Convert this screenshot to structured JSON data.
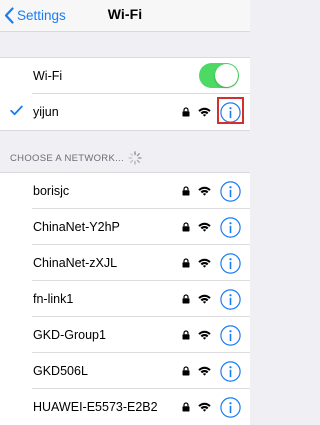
{
  "nav": {
    "back_label": "Settings",
    "title": "Wi-Fi"
  },
  "wifi_toggle": {
    "label": "Wi-Fi",
    "on": true
  },
  "connected": {
    "name": "yijun",
    "secured": true
  },
  "section": {
    "header": "CHOOSE A NETWORK..."
  },
  "networks": [
    {
      "name": "borisjc",
      "secured": true
    },
    {
      "name": "ChinaNet-Y2hP",
      "secured": true
    },
    {
      "name": "ChinaNet-zXJL",
      "secured": true
    },
    {
      "name": "fn-link1",
      "secured": true
    },
    {
      "name": "GKD-Group1",
      "secured": true
    },
    {
      "name": "GKD506L",
      "secured": true
    },
    {
      "name": "HUAWEI-E5573-E2B2",
      "secured": true
    }
  ],
  "colors": {
    "accent": "#1a7cf5",
    "toggle_on": "#4cd964",
    "highlight": "#d32f2f"
  }
}
